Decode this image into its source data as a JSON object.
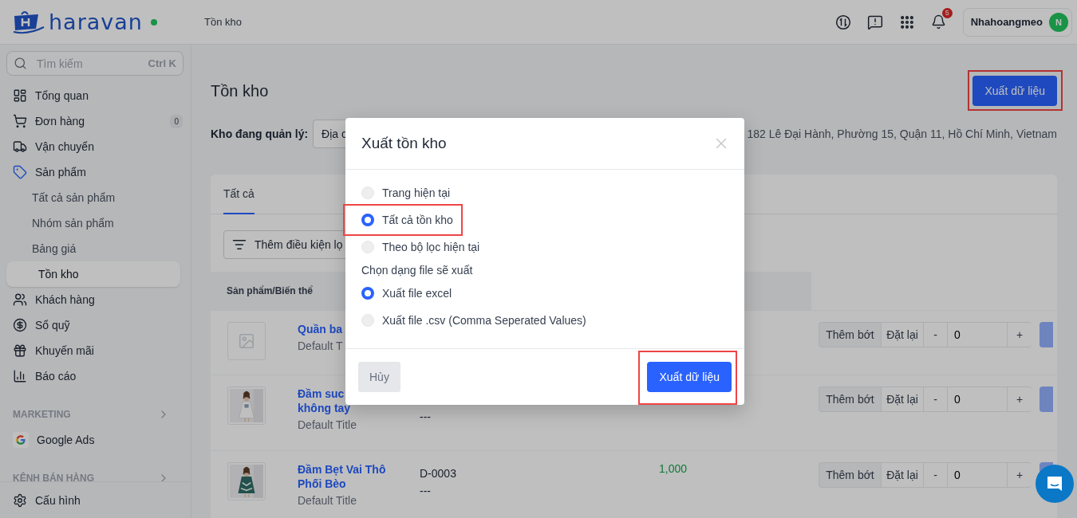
{
  "header": {
    "logo": "haravan",
    "breadcrumb": "Tồn kho",
    "notification_count": "5",
    "user": {
      "name": "Nhahoangmeo",
      "initial": "N"
    }
  },
  "sidebar": {
    "search": {
      "placeholder": "Tìm kiếm",
      "shortcut": "Ctrl K"
    },
    "items": [
      {
        "label": "Tổng quan",
        "kind": "dashboard"
      },
      {
        "label": "Đơn hàng",
        "kind": "cart",
        "badge": "0"
      },
      {
        "label": "Vận chuyển",
        "kind": "truck"
      },
      {
        "label": "Sản phẩm",
        "kind": "tag",
        "expanded": true,
        "children": [
          {
            "label": "Tất cả sản phẩm",
            "selected": false
          },
          {
            "label": "Nhóm sản phẩm",
            "selected": false
          },
          {
            "label": "Bảng giá",
            "selected": false
          },
          {
            "label": "Tồn kho",
            "selected": true
          }
        ]
      },
      {
        "label": "Khách hàng",
        "kind": "users"
      },
      {
        "label": "Sổ quỹ",
        "kind": "dollar"
      },
      {
        "label": "Khuyến mãi",
        "kind": "gift"
      },
      {
        "label": "Báo cáo",
        "kind": "chart"
      }
    ],
    "sections": [
      {
        "title": "MARKETING",
        "items": [
          {
            "label": "Google Ads",
            "kind": "google"
          }
        ]
      },
      {
        "title": "KÊNH BÁN HÀNG"
      }
    ],
    "footer": {
      "label": "Cấu hình"
    }
  },
  "page": {
    "title": "Tồn kho",
    "export_button": {
      "label": "Xuất dữ liệu",
      "highlighted": true
    },
    "warehouse": {
      "label": "Kho đang quản lý:",
      "value": "Địa c",
      "address": "182 Lê Đại Hành, Phường 15, Quận 11, Hồ Chí Minh, Vietnam"
    },
    "tabs": [
      {
        "label": "Tất cả",
        "selected": true
      }
    ],
    "filter": {
      "label": "Thêm điều kiện lọ"
    },
    "table": {
      "columns": [
        "Sản phẩm/Biến thể"
      ],
      "rows": [
        {
          "kind": "placeholder",
          "name": "Quần ba",
          "variant": "Default T",
          "actions": {
            "adjust": "Thêm bớt",
            "reset": "Đặt lại",
            "minus": "-",
            "value": "0",
            "plus": "+"
          }
        },
        {
          "kind": "picture",
          "name": "Đầm suc",
          "name_line2": "không tay",
          "variant": "Default Title",
          "sku_sub": "---",
          "actions": {
            "adjust": "Thêm bớt",
            "reset": "Đặt lại",
            "minus": "-",
            "value": "0",
            "plus": "+"
          }
        },
        {
          "kind": "picture",
          "name": "Đầm Bẹt Vai Thô",
          "name_line2": "Phối Bèo",
          "variant": "Default Title",
          "sku": "D-0003",
          "sku_sub": "---",
          "stock": "1,000",
          "actions": {
            "adjust": "Thêm bớt",
            "reset": "Đặt lại",
            "minus": "-",
            "value": "0",
            "plus": "+"
          }
        }
      ]
    }
  },
  "modal": {
    "title": "Xuất tồn kho",
    "options": [
      {
        "label": "Trang hiện tại",
        "selected": false,
        "highlighted": false
      },
      {
        "label": "Tất cả tồn kho",
        "selected": true,
        "highlighted": true
      },
      {
        "label": "Theo bộ lọc hiện tại",
        "selected": false,
        "highlighted": false
      }
    ],
    "format_label": "Chọn dạng file sẽ xuất",
    "format_options": [
      {
        "label": "Xuất file excel",
        "selected": true
      },
      {
        "label": "Xuất file .csv (Comma Seperated Values)",
        "selected": false
      }
    ],
    "cancel": "Hủy",
    "confirm": {
      "label": "Xuất dữ liệu",
      "highlighted": true
    }
  }
}
